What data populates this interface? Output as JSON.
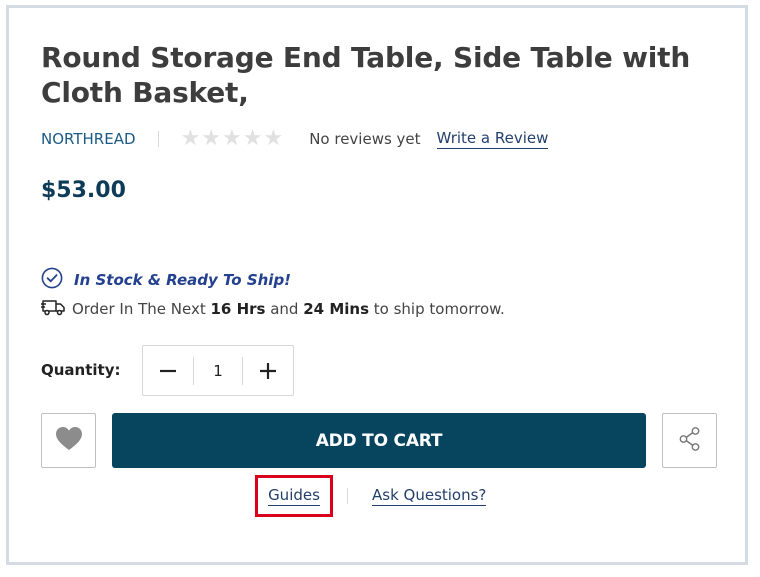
{
  "product": {
    "title": "Round Storage End Table, Side Table with Cloth Basket,",
    "brand": "NORTHREAD",
    "rating": {
      "stars_filled": 0,
      "stars_total": 5
    },
    "reviews_text": "No reviews yet",
    "write_review_label": "Write a Review",
    "price": "$53.00"
  },
  "stock": {
    "status": "In Stock & Ready To Ship!",
    "ship_prefix": "Order In The Next ",
    "hours": "16 Hrs",
    "mid": " and ",
    "mins": "24 Mins",
    "ship_suffix": " to ship tomorrow."
  },
  "quantity": {
    "label": "Quantity:",
    "value": "1"
  },
  "actions": {
    "add_to_cart_label": "ADD TO CART",
    "guides_label": "Guides",
    "ask_label": "Ask Questions?"
  },
  "colors": {
    "primary": "#07455e",
    "brand_link": "#1c5a86",
    "stock_text": "#23418e",
    "highlight_box": "#d8001b"
  },
  "icons": {
    "stock": "check-circle-icon",
    "ship": "delivery-truck-icon",
    "wishlist": "heart-icon",
    "share": "share-icon"
  }
}
